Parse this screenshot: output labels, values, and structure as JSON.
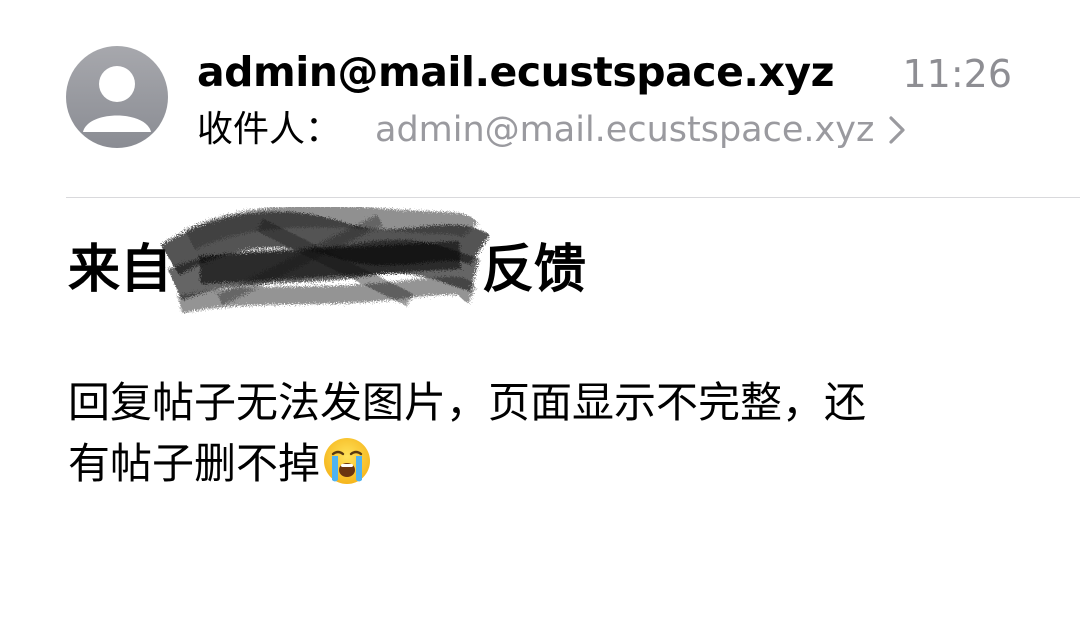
{
  "header": {
    "sender": "admin@mail.ecustspace.xyz",
    "time": "11:26",
    "recipient_label": "收件人：",
    "recipient": "admin@mail.ecustspace.xyz",
    "icons": {
      "avatar": "person-avatar-icon",
      "recipient_chevron": "chevron-right-icon"
    }
  },
  "subject": {
    "prefix": "来自",
    "suffix": "反馈",
    "redaction": "redaction-scribble"
  },
  "body": {
    "line1": "回复帖子无法发图片，页面显示不完整，还",
    "line2": "有帖子删不掉",
    "emoji": "loudly-crying-face-icon"
  },
  "colors": {
    "avatar_gray": "#8e9097",
    "secondary_text": "#8e8e93",
    "divider": "#d9d9dc"
  }
}
